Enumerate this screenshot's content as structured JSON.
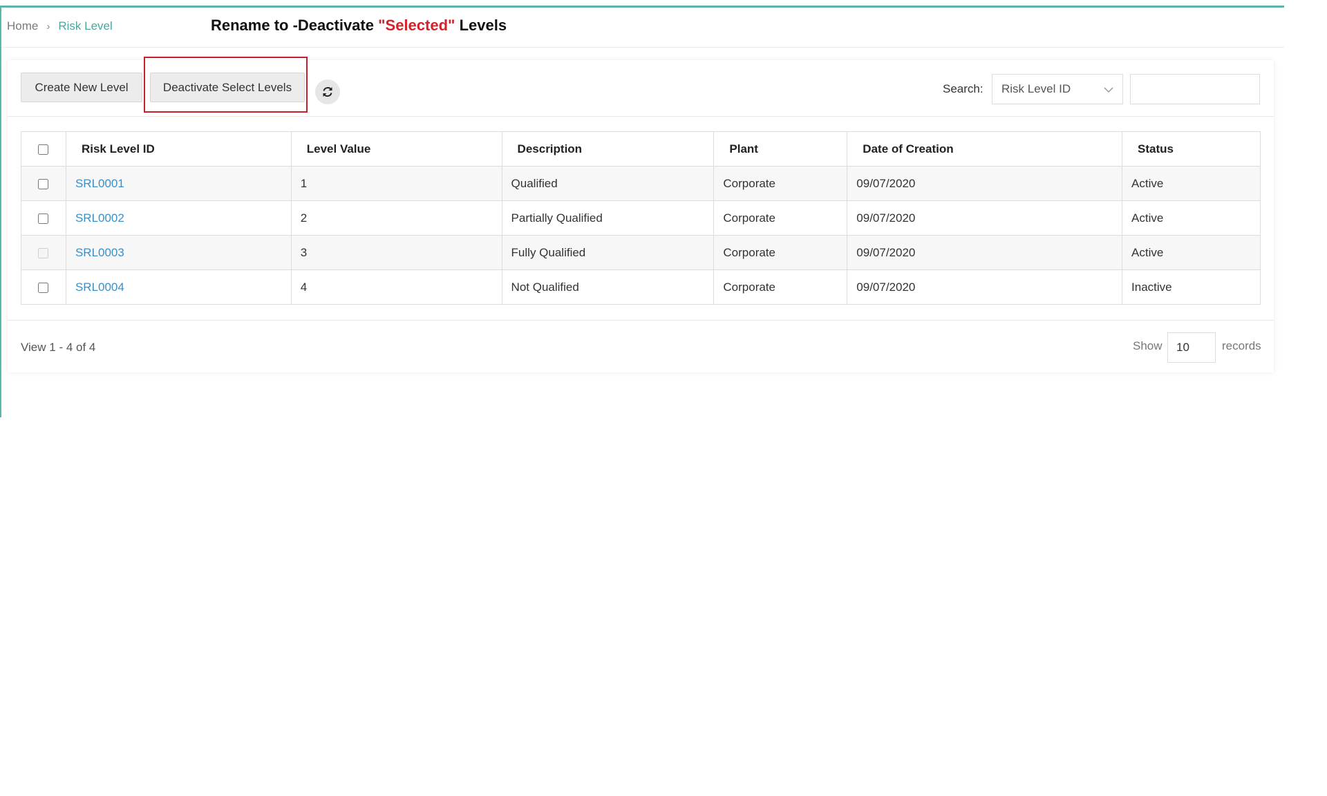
{
  "breadcrumb": {
    "home": "Home",
    "separator": "›",
    "current": "Risk Level"
  },
  "annotation": {
    "prefix": "Rename to -Deactivate ",
    "highlight": "\"Selected\"",
    "suffix": " Levels",
    "highlight_color": "#d2232a"
  },
  "toolbar": {
    "create_label": "Create New Level",
    "deactivate_label": "Deactivate Select Levels",
    "refresh_icon": "refresh-icon"
  },
  "search": {
    "label": "Search:",
    "field_value": "Risk Level ID",
    "input_value": ""
  },
  "table": {
    "headers": [
      "Risk Level ID",
      "Level Value",
      "Description",
      "Plant",
      "Date of Creation",
      "Status"
    ],
    "rows": [
      {
        "id": "SRL0001",
        "value": "1",
        "description": "Qualified",
        "plant": "Corporate",
        "date": "09/07/2020",
        "status": "Active",
        "checkbox_disabled": false
      },
      {
        "id": "SRL0002",
        "value": "2",
        "description": "Partially Qualified",
        "plant": "Corporate",
        "date": "09/07/2020",
        "status": "Active",
        "checkbox_disabled": false
      },
      {
        "id": "SRL0003",
        "value": "3",
        "description": "Fully Qualified",
        "plant": "Corporate",
        "date": "09/07/2020",
        "status": "Active",
        "checkbox_disabled": true
      },
      {
        "id": "SRL0004",
        "value": "4",
        "description": "Not Qualified",
        "plant": "Corporate",
        "date": "09/07/2020",
        "status": "Inactive",
        "checkbox_disabled": false
      }
    ]
  },
  "footer": {
    "view_info": "View 1 - 4 of 4",
    "show_label": "Show",
    "page_size": "10",
    "records_label": "records"
  },
  "colors": {
    "accent": "#5bb5a8",
    "link": "#3a8fc7",
    "annotation_box": "#c8202a"
  }
}
